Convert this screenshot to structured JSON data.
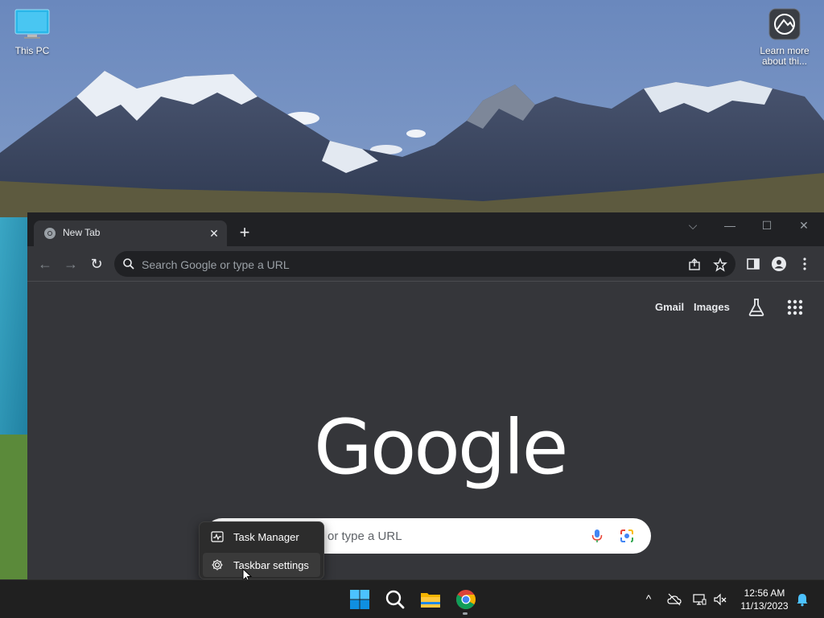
{
  "desktop": {
    "icons": [
      {
        "label": "This PC",
        "icon": "monitor-icon"
      },
      {
        "label": "Learn more about thi...",
        "icon": "camera-icon"
      }
    ]
  },
  "browser": {
    "tab": {
      "title": "New Tab",
      "close_symbol": "✕",
      "favicon": "chrome-icon"
    },
    "new_tab_symbol": "+",
    "window_controls": {
      "dropdown": "⌵",
      "minimize": "—",
      "maximize": "☐",
      "close": "✕"
    },
    "toolbar": {
      "back": "←",
      "forward": "→",
      "reload": "↻",
      "omnibox_placeholder": "Search Google or type a URL"
    },
    "ntp": {
      "links": {
        "gmail": "Gmail",
        "images": "Images"
      },
      "logo_text": "Google",
      "search_placeholder": "or type a URL"
    }
  },
  "context_menu": {
    "items": [
      {
        "label": "Task Manager",
        "icon": "pulse-icon"
      },
      {
        "label": "Taskbar settings",
        "icon": "gear-icon"
      }
    ]
  },
  "taskbar": {
    "apps": [
      "start-icon",
      "search-icon",
      "file-explorer-icon",
      "chrome-icon"
    ],
    "tray": {
      "chevron": "^",
      "time": "12:56 AM",
      "date": "11/13/2023"
    }
  },
  "colors": {
    "browser_bg": "#35363a",
    "titlebar": "#202124",
    "taskbar": "#202020",
    "accent_blue": "#0078d4"
  }
}
